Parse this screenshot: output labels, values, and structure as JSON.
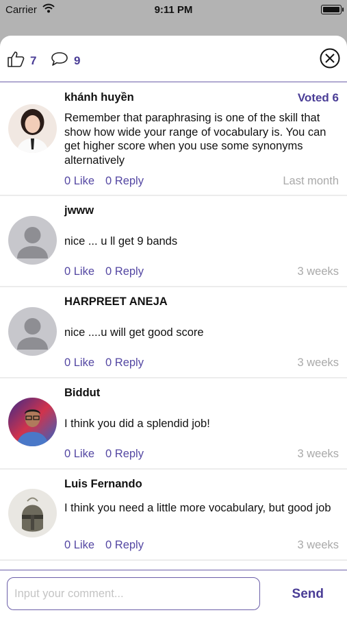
{
  "status_bar": {
    "carrier": "Carrier",
    "time": "9:11 PM"
  },
  "header": {
    "likes_count": "7",
    "comments_count": "9"
  },
  "comments": [
    {
      "name": "khánh huyền",
      "badge": "Voted 6",
      "text": "Remember that paraphrasing is one of the skill that show how wide your range of vocabulary is. You can get higher score when you use some synonyms alternatively",
      "like": "0 Like",
      "reply": "0 Reply",
      "time": "Last month",
      "avatar": "photo-woman"
    },
    {
      "name": "jwww",
      "text": "nice ... u ll get 9 bands",
      "like": "0 Like",
      "reply": "0 Reply",
      "time": "3 weeks",
      "avatar": "default-user"
    },
    {
      "name": "HARPREET ANEJA",
      "text": "nice ....u will get good score",
      "like": "0 Like",
      "reply": "0 Reply",
      "time": "3 weeks",
      "avatar": "default-user"
    },
    {
      "name": "Biddut",
      "text": "I think you did a splendid job!",
      "like": "0 Like",
      "reply": "0 Reply",
      "time": "3 weeks",
      "avatar": "photo-man"
    },
    {
      "name": "Luis Fernando",
      "text": "I think you need a little more vocabulary, but good job",
      "like": "0 Like",
      "reply": "0 Reply",
      "time": "3 weeks",
      "avatar": "photo-helmet"
    }
  ],
  "footer": {
    "input_placeholder": "Input your comment...",
    "send_label": "Send"
  },
  "colors": {
    "accent": "#4a3d96",
    "link": "#5346a2",
    "muted": "#a9a9a9"
  }
}
